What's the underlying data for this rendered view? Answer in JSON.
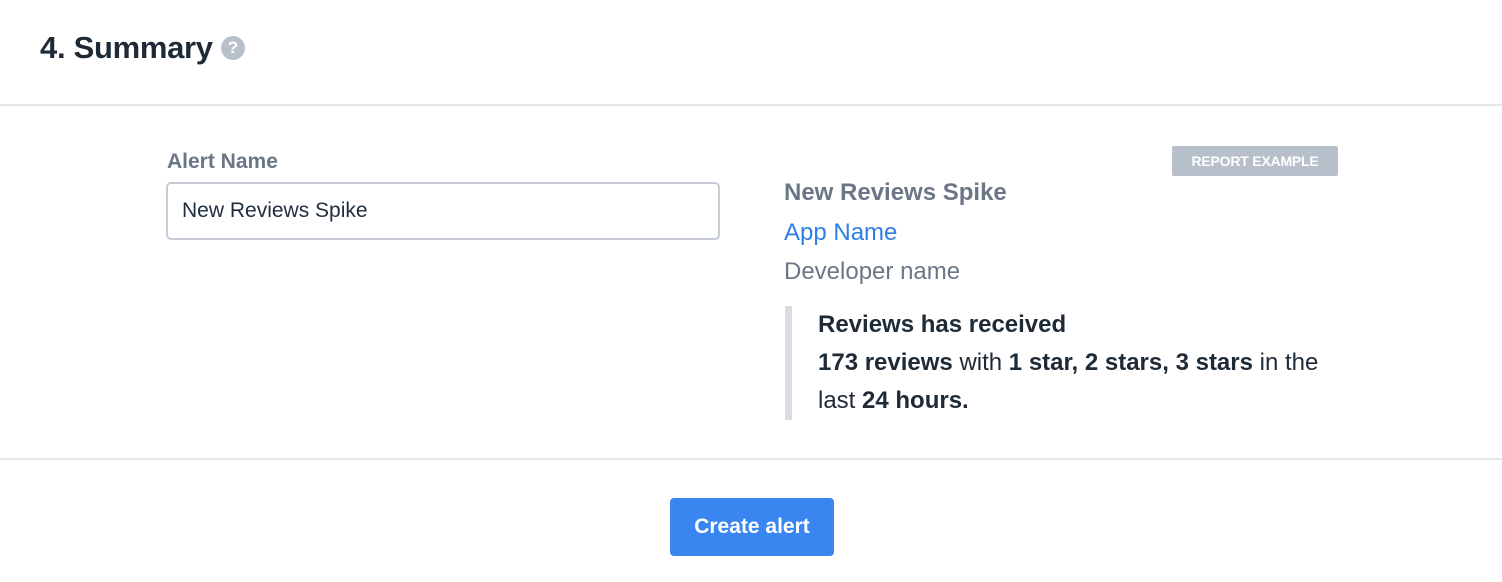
{
  "header": {
    "title": "4. Summary",
    "help_icon": "?"
  },
  "form": {
    "alert_name_label": "Alert Name",
    "alert_name_value": "New Reviews Spike"
  },
  "preview": {
    "badge": "REPORT EXAMPLE",
    "alert_title": "New Reviews Spike",
    "app_name": "App Name",
    "developer_name": "Developer name",
    "message": {
      "line1": "Reviews has received",
      "count": "173 reviews",
      "with": " with ",
      "stars": "1 star, 2 stars, 3 stars",
      "in_the": " in the",
      "last": "last ",
      "period": "24 hours."
    },
    "link_color": "#2f80e6"
  },
  "footer": {
    "create_label": "Create alert",
    "button_color": "#3a86f0"
  }
}
